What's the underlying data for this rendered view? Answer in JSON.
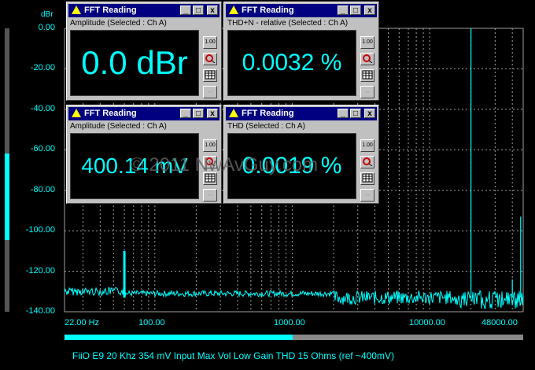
{
  "unit_label": "dBr",
  "y_ticks": [
    "0.00",
    "-20.00",
    "-40.00",
    "-60.00",
    "-80.00",
    "-100.00",
    "-120.00",
    "-140.00"
  ],
  "x_ticks": [
    "22.00 Hz",
    "100.00",
    "1000.00",
    "10000.00",
    "48000.00"
  ],
  "caption": "FiiO E9 20 Khz 354 mV Input Max Vol Low Gain THD 15 Ohms (ref ~400mV)",
  "watermark": "© 2011 NwAvGuy.com",
  "colors": {
    "trace": "#00ffff",
    "grid": "#a0a0a0",
    "title_bar": "#000080",
    "window": "#c0c0c0"
  },
  "windows": [
    {
      "title": "FFT Reading",
      "subtitle": "Amplitude (Selected : Ch A)",
      "value": "0.0 dBr"
    },
    {
      "title": "FFT Reading",
      "subtitle": "THD+N - relative (Selected : Ch A)",
      "value": "0.0032 %"
    },
    {
      "title": "FFT Reading",
      "subtitle": "Amplitude (Selected : Ch A)",
      "value": "400.14 mV"
    },
    {
      "title": "FFT Reading",
      "subtitle": "THD (Selected : Ch A)",
      "value": "0.0019 %"
    }
  ],
  "window_buttons": {
    "minimize": "_",
    "maximize": "□",
    "close": "x"
  },
  "side_buttons": {
    "scale": "1.00",
    "probe": "probe-icon",
    "table": "table-icon",
    "move": "↔"
  }
}
